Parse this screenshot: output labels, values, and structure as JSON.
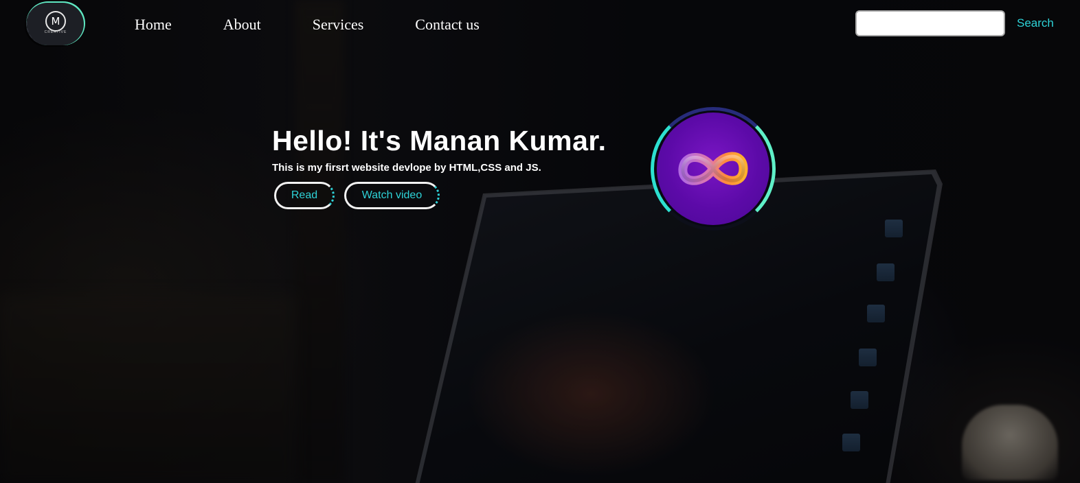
{
  "header": {
    "logo": {
      "letter": "M",
      "tagline": "CREATIVE",
      "accent_color": "#5fe8c2"
    },
    "nav": [
      {
        "label": "Home"
      },
      {
        "label": "About"
      },
      {
        "label": "Services"
      },
      {
        "label": "Contact us"
      }
    ],
    "search": {
      "value": "",
      "placeholder": "",
      "button_label": "Search"
    }
  },
  "hero": {
    "title": "Hello! It's Manan Kumar.",
    "subtitle": "This is my firsrt website devlope by HTML,CSS and JS.",
    "buttons": [
      {
        "label": "Read"
      },
      {
        "label": "Watch video"
      }
    ],
    "avatar_icon": "infinity-icon"
  },
  "colors": {
    "accent": "#2ed3d8",
    "avatar_bg": "#5c0aa8",
    "infinity_gradient": [
      "#b06adf",
      "#ff8a3d",
      "#ffb02e"
    ]
  }
}
